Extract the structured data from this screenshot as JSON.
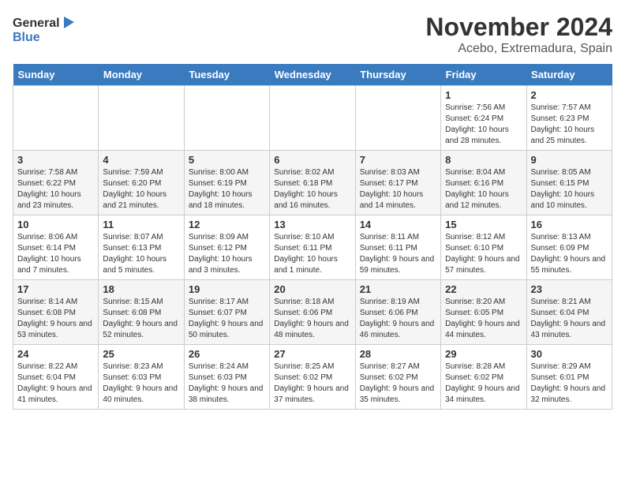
{
  "logo": {
    "line1": "General",
    "line2": "Blue"
  },
  "title": "November 2024",
  "location": "Acebo, Extremadura, Spain",
  "weekdays": [
    "Sunday",
    "Monday",
    "Tuesday",
    "Wednesday",
    "Thursday",
    "Friday",
    "Saturday"
  ],
  "weeks": [
    [
      {
        "day": "",
        "info": ""
      },
      {
        "day": "",
        "info": ""
      },
      {
        "day": "",
        "info": ""
      },
      {
        "day": "",
        "info": ""
      },
      {
        "day": "",
        "info": ""
      },
      {
        "day": "1",
        "info": "Sunrise: 7:56 AM\nSunset: 6:24 PM\nDaylight: 10 hours and 28 minutes."
      },
      {
        "day": "2",
        "info": "Sunrise: 7:57 AM\nSunset: 6:23 PM\nDaylight: 10 hours and 25 minutes."
      }
    ],
    [
      {
        "day": "3",
        "info": "Sunrise: 7:58 AM\nSunset: 6:22 PM\nDaylight: 10 hours and 23 minutes."
      },
      {
        "day": "4",
        "info": "Sunrise: 7:59 AM\nSunset: 6:20 PM\nDaylight: 10 hours and 21 minutes."
      },
      {
        "day": "5",
        "info": "Sunrise: 8:00 AM\nSunset: 6:19 PM\nDaylight: 10 hours and 18 minutes."
      },
      {
        "day": "6",
        "info": "Sunrise: 8:02 AM\nSunset: 6:18 PM\nDaylight: 10 hours and 16 minutes."
      },
      {
        "day": "7",
        "info": "Sunrise: 8:03 AM\nSunset: 6:17 PM\nDaylight: 10 hours and 14 minutes."
      },
      {
        "day": "8",
        "info": "Sunrise: 8:04 AM\nSunset: 6:16 PM\nDaylight: 10 hours and 12 minutes."
      },
      {
        "day": "9",
        "info": "Sunrise: 8:05 AM\nSunset: 6:15 PM\nDaylight: 10 hours and 10 minutes."
      }
    ],
    [
      {
        "day": "10",
        "info": "Sunrise: 8:06 AM\nSunset: 6:14 PM\nDaylight: 10 hours and 7 minutes."
      },
      {
        "day": "11",
        "info": "Sunrise: 8:07 AM\nSunset: 6:13 PM\nDaylight: 10 hours and 5 minutes."
      },
      {
        "day": "12",
        "info": "Sunrise: 8:09 AM\nSunset: 6:12 PM\nDaylight: 10 hours and 3 minutes."
      },
      {
        "day": "13",
        "info": "Sunrise: 8:10 AM\nSunset: 6:11 PM\nDaylight: 10 hours and 1 minute."
      },
      {
        "day": "14",
        "info": "Sunrise: 8:11 AM\nSunset: 6:11 PM\nDaylight: 9 hours and 59 minutes."
      },
      {
        "day": "15",
        "info": "Sunrise: 8:12 AM\nSunset: 6:10 PM\nDaylight: 9 hours and 57 minutes."
      },
      {
        "day": "16",
        "info": "Sunrise: 8:13 AM\nSunset: 6:09 PM\nDaylight: 9 hours and 55 minutes."
      }
    ],
    [
      {
        "day": "17",
        "info": "Sunrise: 8:14 AM\nSunset: 6:08 PM\nDaylight: 9 hours and 53 minutes."
      },
      {
        "day": "18",
        "info": "Sunrise: 8:15 AM\nSunset: 6:08 PM\nDaylight: 9 hours and 52 minutes."
      },
      {
        "day": "19",
        "info": "Sunrise: 8:17 AM\nSunset: 6:07 PM\nDaylight: 9 hours and 50 minutes."
      },
      {
        "day": "20",
        "info": "Sunrise: 8:18 AM\nSunset: 6:06 PM\nDaylight: 9 hours and 48 minutes."
      },
      {
        "day": "21",
        "info": "Sunrise: 8:19 AM\nSunset: 6:06 PM\nDaylight: 9 hours and 46 minutes."
      },
      {
        "day": "22",
        "info": "Sunrise: 8:20 AM\nSunset: 6:05 PM\nDaylight: 9 hours and 44 minutes."
      },
      {
        "day": "23",
        "info": "Sunrise: 8:21 AM\nSunset: 6:04 PM\nDaylight: 9 hours and 43 minutes."
      }
    ],
    [
      {
        "day": "24",
        "info": "Sunrise: 8:22 AM\nSunset: 6:04 PM\nDaylight: 9 hours and 41 minutes."
      },
      {
        "day": "25",
        "info": "Sunrise: 8:23 AM\nSunset: 6:03 PM\nDaylight: 9 hours and 40 minutes."
      },
      {
        "day": "26",
        "info": "Sunrise: 8:24 AM\nSunset: 6:03 PM\nDaylight: 9 hours and 38 minutes."
      },
      {
        "day": "27",
        "info": "Sunrise: 8:25 AM\nSunset: 6:02 PM\nDaylight: 9 hours and 37 minutes."
      },
      {
        "day": "28",
        "info": "Sunrise: 8:27 AM\nSunset: 6:02 PM\nDaylight: 9 hours and 35 minutes."
      },
      {
        "day": "29",
        "info": "Sunrise: 8:28 AM\nSunset: 6:02 PM\nDaylight: 9 hours and 34 minutes."
      },
      {
        "day": "30",
        "info": "Sunrise: 8:29 AM\nSunset: 6:01 PM\nDaylight: 9 hours and 32 minutes."
      }
    ]
  ]
}
